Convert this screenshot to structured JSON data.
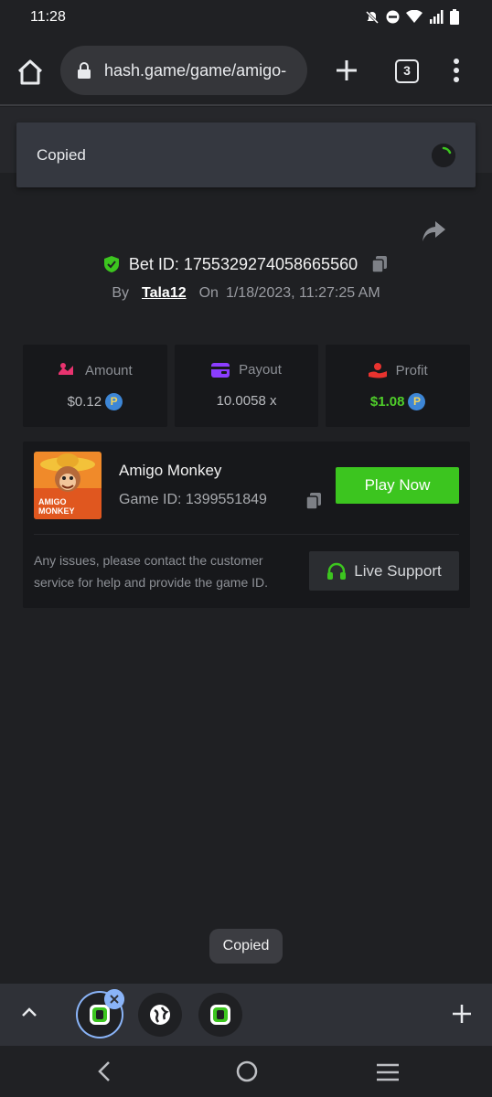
{
  "status_bar": {
    "time": "11:28"
  },
  "browser": {
    "url": "hash.game/game/amigo-",
    "tab_count": "3"
  },
  "toast_top": {
    "text": "Copied"
  },
  "bet": {
    "id_label": "Bet ID: 1755329274058665560",
    "by_label": "By",
    "user": "Tala12",
    "on_label": "On",
    "date": "1/18/2023, 11:27:25 AM"
  },
  "stats": {
    "amount": {
      "label": "Amount",
      "value": "$0.12"
    },
    "payout": {
      "label": "Payout",
      "value": "10.0058 x"
    },
    "profit": {
      "label": "Profit",
      "value": "$1.08"
    },
    "coin_symbol": "P"
  },
  "game": {
    "name": "Amigo Monkey",
    "id_label": "Game ID: 1399551849",
    "play_label": "Play Now",
    "thumb_text_1": "AMIGO",
    "thumb_text_2": "MONKEY",
    "help_text": "Any issues, please contact the customer service for help and provide the game ID.",
    "support_label": "Live Support"
  },
  "toast_bottom": {
    "text": "Copied"
  },
  "colors": {
    "accent_green": "#3cc51f",
    "profit_green": "#4fce2a",
    "coin_blue": "#3d86d6",
    "amount_pink": "#e8336f",
    "payout_purple": "#8b3dff",
    "profit_red": "#e8332f"
  },
  "icons": [
    "home-icon",
    "lock-icon",
    "plus-icon",
    "menu-icon",
    "share-icon",
    "shield-icon",
    "copy-icon",
    "headset-icon",
    "chevron-up-icon",
    "globe-icon",
    "close-icon",
    "back-icon",
    "circle-home-icon",
    "recents-icon"
  ]
}
